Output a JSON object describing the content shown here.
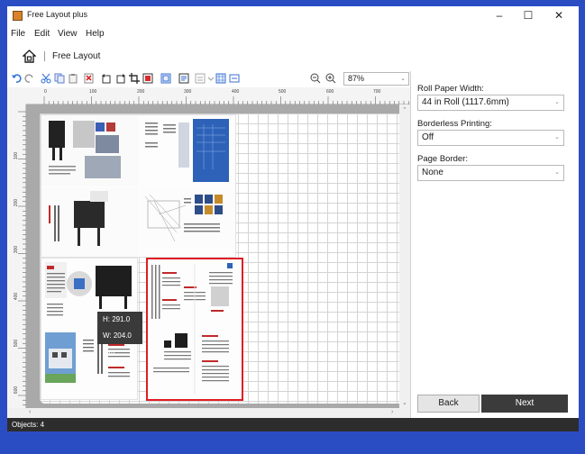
{
  "window": {
    "title": "Free Layout plus",
    "controls": [
      "–",
      "☐",
      "✕"
    ]
  },
  "menu": [
    "File",
    "Edit",
    "View",
    "Help"
  ],
  "breadcrumb": {
    "label": "Free Layout"
  },
  "toolbar": {
    "zoom_value": "87%",
    "icons": [
      "undo-icon",
      "redo-icon",
      "cut-icon",
      "copy-icon",
      "paste-icon",
      "delete-icon",
      "rotate-left-icon",
      "rotate-right-icon",
      "crop-icon",
      "fit-icon",
      "fullscreen-icon",
      "paper-icon",
      "align-icon",
      "grid-icon",
      "snap-icon",
      "zoom-out-icon",
      "zoom-in-icon"
    ]
  },
  "ruler": {
    "h_marks": [
      "0",
      "100",
      "200",
      "300",
      "400",
      "500",
      "600",
      "700"
    ],
    "v_marks": [
      "100",
      "200",
      "300",
      "400",
      "500",
      "600"
    ]
  },
  "canvas": {
    "tooltip": {
      "height": "H: 291.0 mm",
      "width": "W: 204.0 mm"
    }
  },
  "panel": {
    "roll_width_label": "Roll Paper Width:",
    "roll_width_value": "44 in Roll (1117.6mm)",
    "borderless_label": "Borderless Printing:",
    "borderless_value": "Off",
    "page_border_label": "Page Border:",
    "page_border_value": "None",
    "back_label": "Back",
    "next_label": "Next"
  },
  "status": {
    "objects": "Objects: 4"
  },
  "colors": {
    "selection": "#e01c24",
    "accent": "#2b4dc4",
    "next_button": "#3b3b3b"
  }
}
